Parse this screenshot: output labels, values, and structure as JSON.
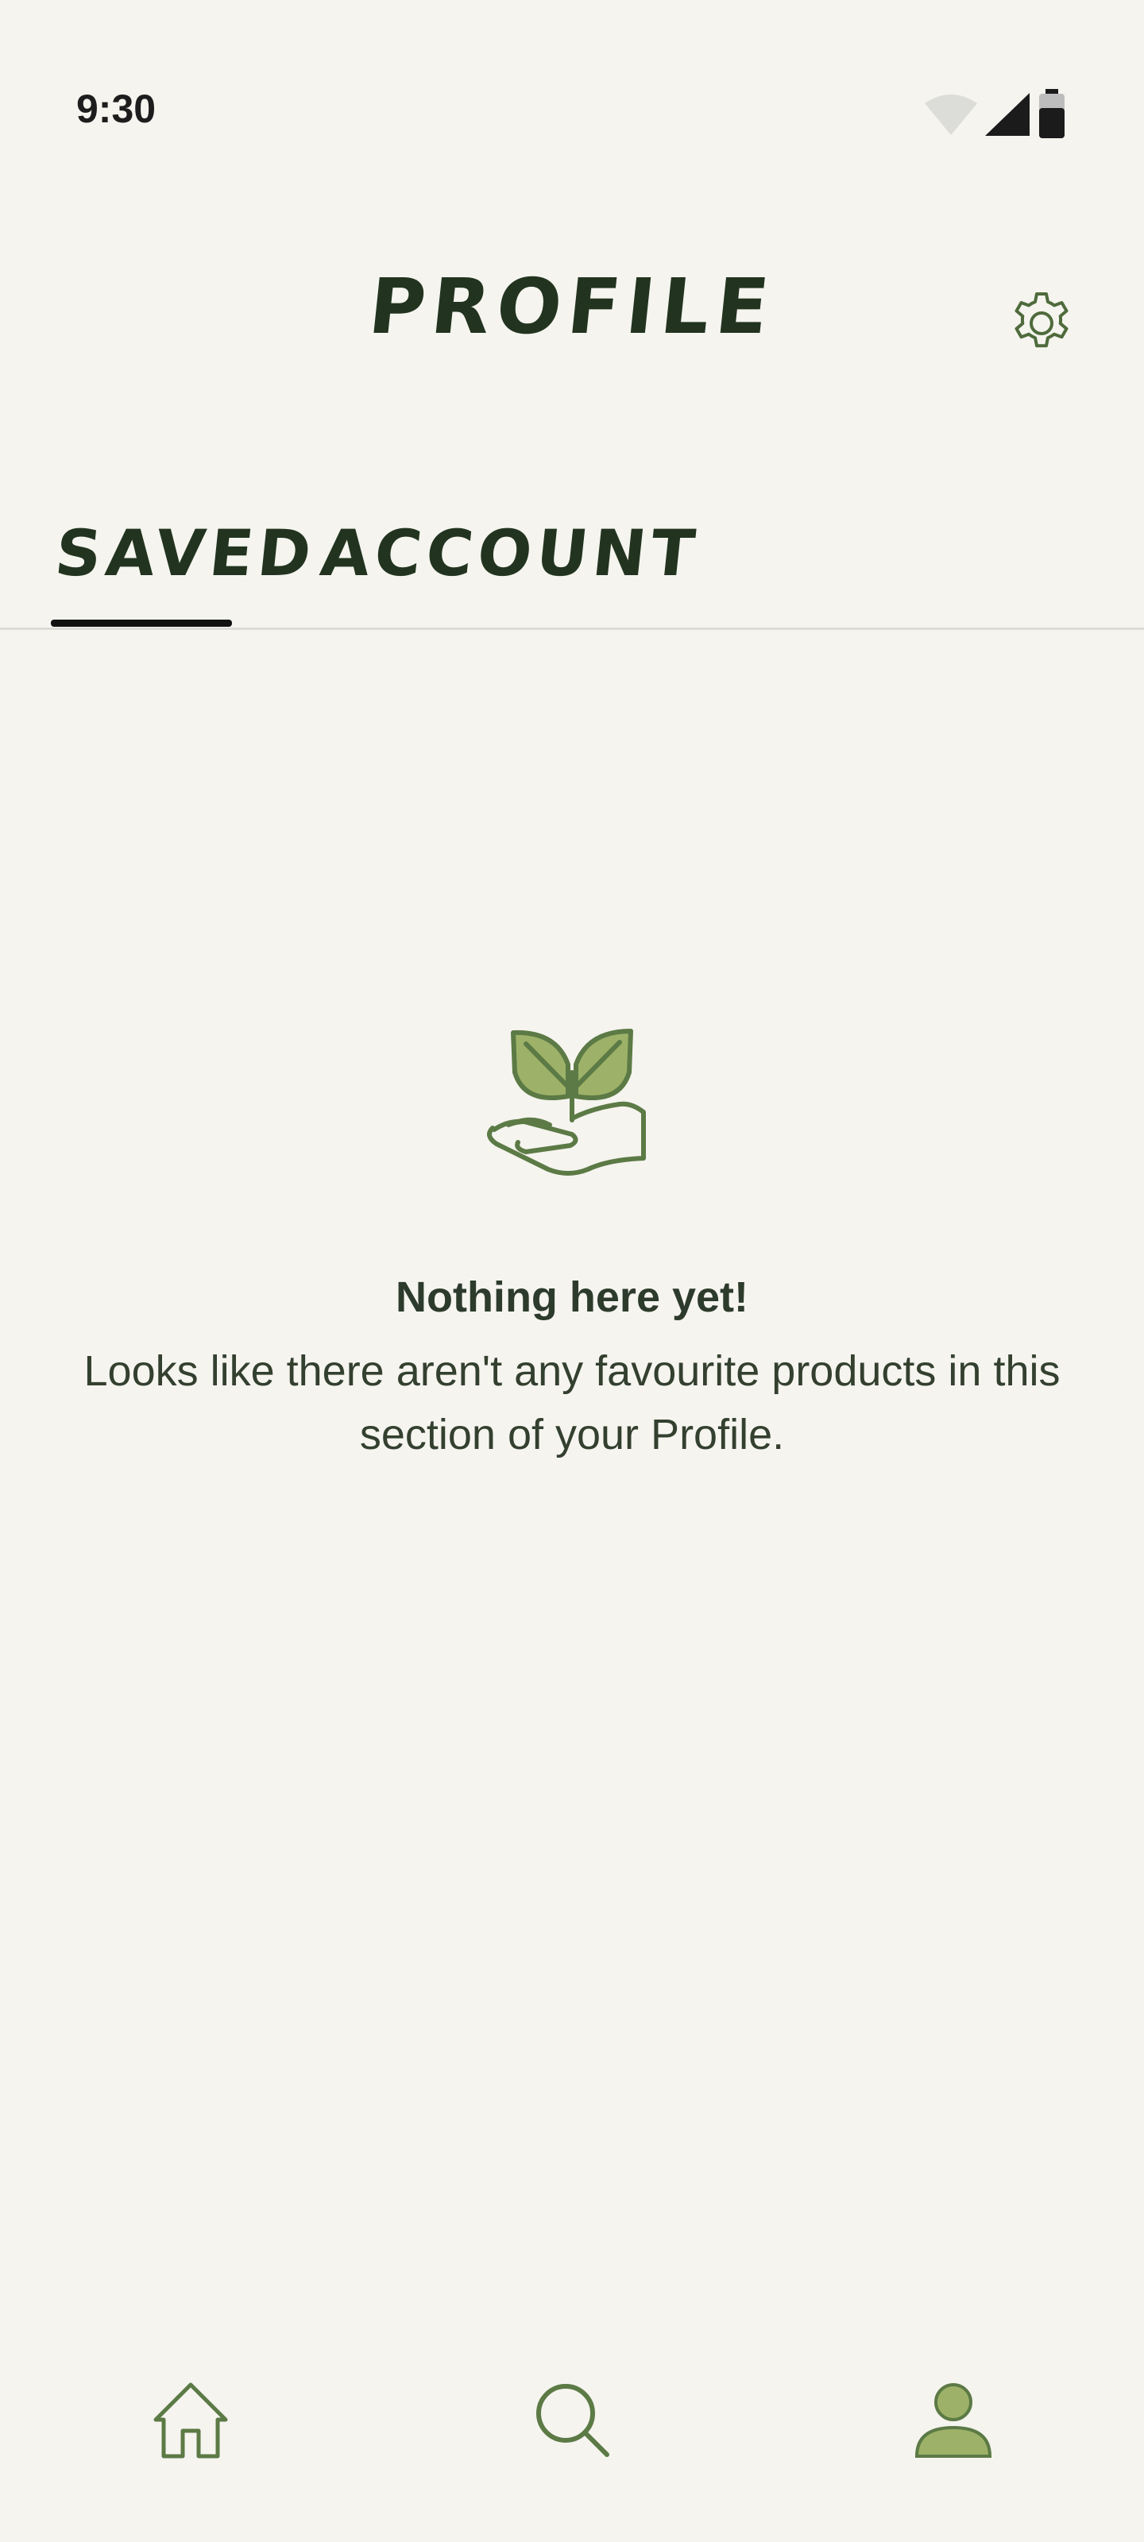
{
  "status_bar": {
    "time": "9:30",
    "icons": [
      "wifi-icon",
      "signal-icon",
      "battery-icon"
    ]
  },
  "header": {
    "title": "PROFILE",
    "settings_icon": "gear-icon"
  },
  "tabs": [
    {
      "label": "SAVED",
      "active": true
    },
    {
      "label": "ACCOUNT",
      "active": false
    }
  ],
  "empty_state": {
    "illustration": "plant-in-hand-icon",
    "title": "Nothing here yet!",
    "description": "Looks like there aren't any favourite products in this section of your Profile."
  },
  "bottom_nav": {
    "items": [
      {
        "icon": "home-icon",
        "active": false
      },
      {
        "icon": "search-icon",
        "active": false
      },
      {
        "icon": "profile-icon",
        "active": true
      }
    ]
  },
  "colors": {
    "background": "#f5f4ef",
    "primary_dark": "#22341f",
    "accent_green": "#5c7a45",
    "leaf_fill": "#9db268",
    "divider": "#dedcd6"
  }
}
